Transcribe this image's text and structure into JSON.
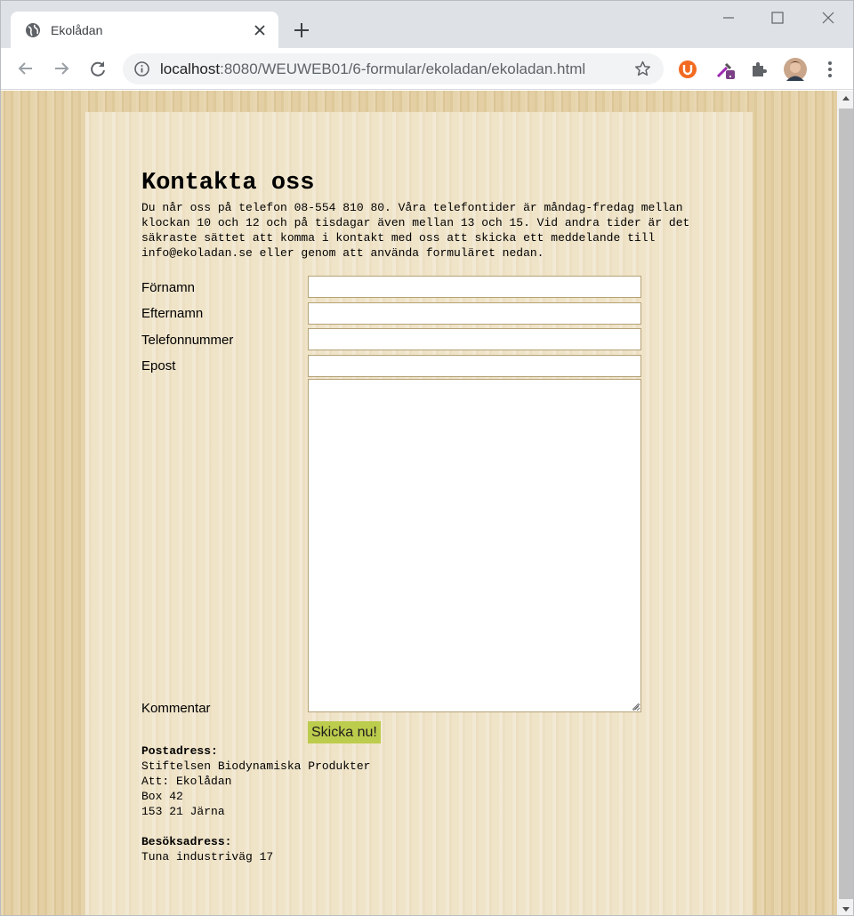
{
  "browser": {
    "tab_title": "Ekolådan",
    "url_host": "localhost",
    "url_path": ":8080/WEUWEB01/6-formular/ekoladan/ekoladan.html"
  },
  "page": {
    "heading": "Kontakta oss",
    "intro": "Du når oss på telefon 08-554 810 80. Våra telefontider är måndag-fredag mellan klockan 10 och 12 och på tisdagar även mellan 13 och 15. Vid andra tider är det säkraste sättet att komma i kontakt med oss att skicka ett meddelande till info@ekoladan.se eller genom att använda formuläret nedan.",
    "form": {
      "firstname_label": "Förnamn",
      "lastname_label": "Efternamn",
      "phone_label": "Telefonnummer",
      "email_label": "Epost",
      "comment_label": "Kommentar",
      "submit_label": "Skicka nu!"
    },
    "postal": {
      "heading": "Postadress:",
      "line1": "Stiftelsen Biodynamiska Produkter",
      "line2": "Att: Ekolådan",
      "line3": "Box 42",
      "line4": "153 21 Järna"
    },
    "visit": {
      "heading": "Besöksadress:",
      "line1": "Tuna industriväg 17"
    }
  },
  "colors": {
    "submit_bg": "#bccc4c",
    "paper_bg": "#efe3c8",
    "wood_bg": "#e3cfa3"
  }
}
